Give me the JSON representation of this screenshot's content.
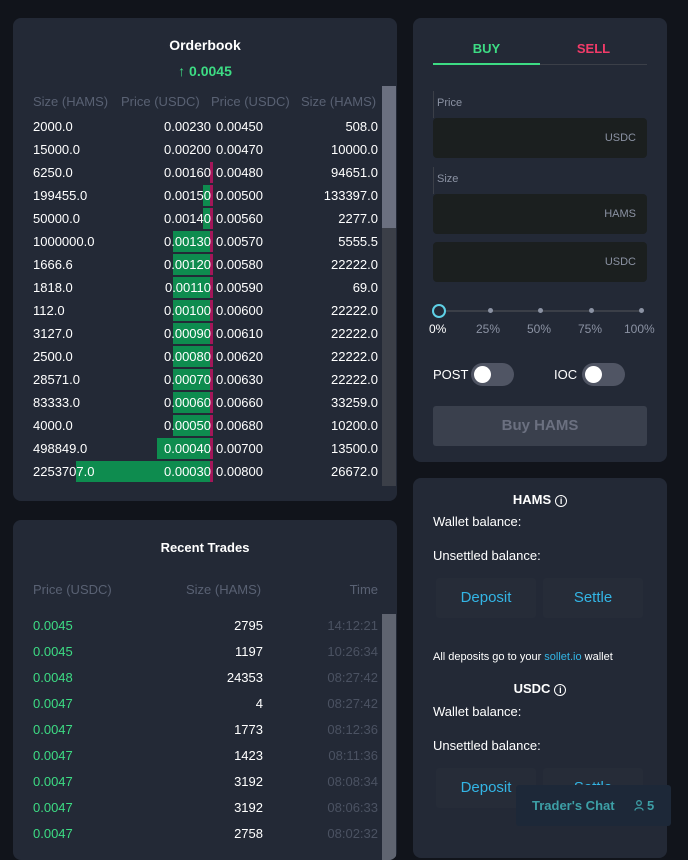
{
  "orderbook": {
    "title": "Orderbook",
    "mid_price": "↑ 0.0045",
    "headers": [
      "Size (HAMS)",
      "Price (USDC)",
      "Price (USDC)",
      "Size (HAMS)"
    ],
    "rows": [
      {
        "bid_size": "2000.0",
        "bid_price": "0.00230",
        "ask_price": "0.00450",
        "ask_size": "508.0",
        "bid_depth": 0.0,
        "ask_depth": 0.0
      },
      {
        "bid_size": "15000.0",
        "bid_price": "0.00200",
        "ask_price": "0.00470",
        "ask_size": "10000.0",
        "bid_depth": 0.0,
        "ask_depth": 0.0
      },
      {
        "bid_size": "6250.0",
        "bid_price": "0.00160",
        "ask_price": "0.00480",
        "ask_size": "94651.0",
        "bid_depth": 0.0,
        "ask_depth": 0.6
      },
      {
        "bid_size": "199455.0",
        "bid_price": "0.00150",
        "ask_price": "0.00500",
        "ask_size": "133397.0",
        "bid_depth": 0.06,
        "ask_depth": 0.6
      },
      {
        "bid_size": "50000.0",
        "bid_price": "0.00140",
        "ask_price": "0.00560",
        "ask_size": "2277.0",
        "bid_depth": 0.06,
        "ask_depth": 0.6
      },
      {
        "bid_size": "1000000.0",
        "bid_price": "0.00130",
        "ask_price": "0.00570",
        "ask_size": "5555.5",
        "bid_depth": 0.28,
        "ask_depth": 0.6
      },
      {
        "bid_size": "1666.6",
        "bid_price": "0.00120",
        "ask_price": "0.00580",
        "ask_size": "22222.0",
        "bid_depth": 0.28,
        "ask_depth": 0.6
      },
      {
        "bid_size": "1818.0",
        "bid_price": "0.00110",
        "ask_price": "0.00590",
        "ask_size": "69.0",
        "bid_depth": 0.28,
        "ask_depth": 0.6
      },
      {
        "bid_size": "112.0",
        "bid_price": "0.00100",
        "ask_price": "0.00600",
        "ask_size": "22222.0",
        "bid_depth": 0.28,
        "ask_depth": 0.6
      },
      {
        "bid_size": "3127.0",
        "bid_price": "0.00090",
        "ask_price": "0.00610",
        "ask_size": "22222.0",
        "bid_depth": 0.28,
        "ask_depth": 0.6
      },
      {
        "bid_size": "2500.0",
        "bid_price": "0.00080",
        "ask_price": "0.00620",
        "ask_size": "22222.0",
        "bid_depth": 0.28,
        "ask_depth": 0.6
      },
      {
        "bid_size": "28571.0",
        "bid_price": "0.00070",
        "ask_price": "0.00630",
        "ask_size": "22222.0",
        "bid_depth": 0.28,
        "ask_depth": 0.6
      },
      {
        "bid_size": "83333.0",
        "bid_price": "0.00060",
        "ask_price": "0.00660",
        "ask_size": "33259.0",
        "bid_depth": 0.28,
        "ask_depth": 0.6
      },
      {
        "bid_size": "4000.0",
        "bid_price": "0.00050",
        "ask_price": "0.00680",
        "ask_size": "10200.0",
        "bid_depth": 0.28,
        "ask_depth": 0.6
      },
      {
        "bid_size": "498849.0",
        "bid_price": "0.00040",
        "ask_price": "0.00700",
        "ask_size": "13500.0",
        "bid_depth": 0.4,
        "ask_depth": 0.6
      },
      {
        "bid_size": "2253707.0",
        "bid_price": "0.00030",
        "ask_price": "0.00800",
        "ask_size": "26672.0",
        "bid_depth": 1.0,
        "ask_depth": 0.6
      }
    ]
  },
  "trades": {
    "title": "Recent Trades",
    "headers": [
      "Price (USDC)",
      "Size (HAMS)",
      "Time"
    ],
    "rows": [
      {
        "price": "0.0045",
        "size": "2795",
        "time": "14:12:21"
      },
      {
        "price": "0.0045",
        "size": "1197",
        "time": "10:26:34"
      },
      {
        "price": "0.0048",
        "size": "24353",
        "time": "08:27:42"
      },
      {
        "price": "0.0047",
        "size": "4",
        "time": "08:27:42"
      },
      {
        "price": "0.0047",
        "size": "1773",
        "time": "08:12:36"
      },
      {
        "price": "0.0047",
        "size": "1423",
        "time": "08:11:36"
      },
      {
        "price": "0.0047",
        "size": "3192",
        "time": "08:08:34"
      },
      {
        "price": "0.0047",
        "size": "3192",
        "time": "08:06:33"
      },
      {
        "price": "0.0047",
        "size": "2758",
        "time": "08:02:32"
      }
    ]
  },
  "form": {
    "buy_tab": "BUY",
    "sell_tab": "SELL",
    "price_label": "Price",
    "price_value": "",
    "price_unit": "USDC",
    "size_label": "Size",
    "size_value": "",
    "size_unit": "HAMS",
    "total_value": "",
    "total_unit": "USDC",
    "slider_level": 0,
    "slider_marks": [
      "0%",
      "25%",
      "50%",
      "75%",
      "100%"
    ],
    "post_label": "POST",
    "post_on": false,
    "ioc_label": "IOC",
    "ioc_on": false,
    "submit_label": "Buy HAMS"
  },
  "balances": {
    "base": {
      "title": "HAMS",
      "wallet_label": "Wallet balance:",
      "unsettled_label": "Unsettled balance:",
      "deposit_label": "Deposit",
      "settle_label": "Settle"
    },
    "note_prefix": "All deposits go to your ",
    "note_link": "sollet.io",
    "note_suffix": " wallet",
    "quote": {
      "title": "USDC",
      "wallet_label": "Wallet balance:",
      "unsettled_label": "Unsettled balance:",
      "deposit_label": "Deposit",
      "settle_label": "Settle"
    }
  },
  "chat": {
    "label": "Trader's Chat",
    "count": "5"
  },
  "colors": {
    "bid": "#0e8c4f",
    "ask": "#a31659",
    "up": "#3ddc84",
    "sell": "#f23b69",
    "link": "#33b5e5"
  },
  "icons": [
    "arrow-up-icon",
    "info-icon",
    "user-icon"
  ]
}
